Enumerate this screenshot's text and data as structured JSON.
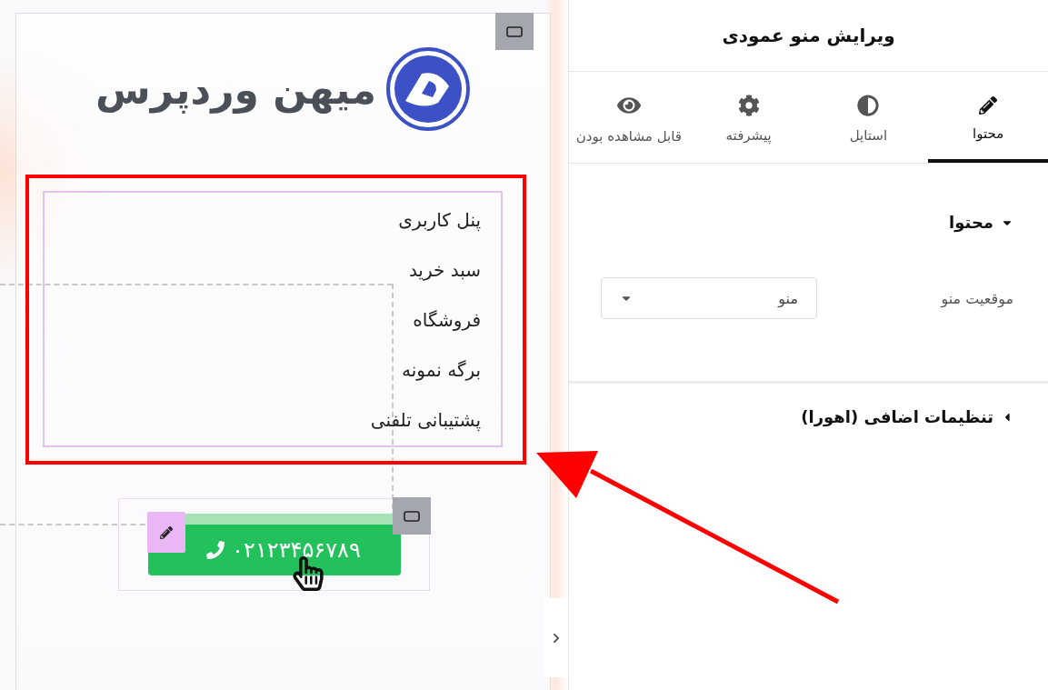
{
  "preview": {
    "logo_text": "میهن وردپرس",
    "menu_items": [
      "پنل کاربری",
      "سبد خرید",
      "فروشگاه",
      "برگه نمونه",
      "پشتیبانی تلفنی"
    ],
    "phone_button": "۰۲۱۲۳۴۵۶۷۸۹"
  },
  "panel": {
    "title": "ویرایش منو عمودی",
    "tabs": [
      {
        "label": "محتوا",
        "selected": true
      },
      {
        "label": "استایل",
        "selected": false
      },
      {
        "label": "پیشرفته",
        "selected": false
      },
      {
        "label": "قابل مشاهده بودن",
        "selected": false
      }
    ],
    "sections": [
      {
        "title": "محتوا",
        "expanded": true,
        "fields": [
          {
            "label": "موقعیت منو",
            "value": "منو"
          }
        ]
      },
      {
        "title": "تنظیمات اضافی (اهورا)",
        "expanded": false
      }
    ]
  }
}
